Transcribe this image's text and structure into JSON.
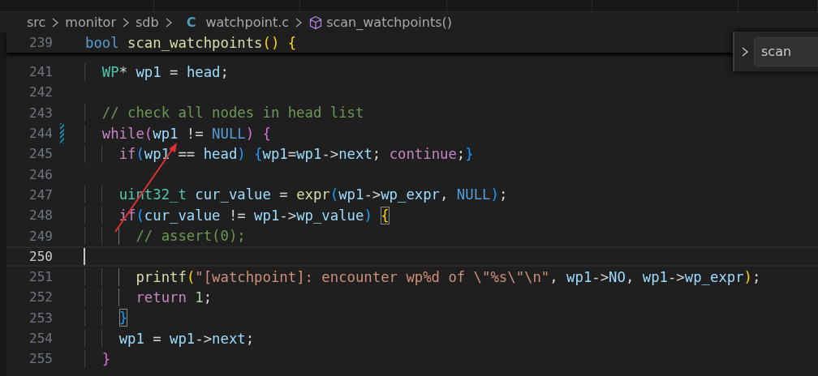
{
  "breadcrumb": {
    "segments": [
      {
        "label": "src",
        "kind": "folder"
      },
      {
        "label": "monitor",
        "kind": "folder"
      },
      {
        "label": "sdb",
        "kind": "folder"
      },
      {
        "label": "watchpoint.c",
        "kind": "file",
        "badge": "C"
      },
      {
        "label": "scan_watchpoints()",
        "kind": "symbol"
      }
    ]
  },
  "sticky_line": {
    "number": "239",
    "tokens": [
      {
        "t": "bool ",
        "color": "#569cd6"
      },
      {
        "t": "scan_watchpoints",
        "color": "#dcdcaa"
      },
      {
        "t": "() {",
        "color": "#ffd700"
      }
    ]
  },
  "lines": [
    {
      "number": "241",
      "current": false,
      "modified": false,
      "tokens": [
        {
          "t": "  WP",
          "color": "#4ec9b0"
        },
        {
          "t": "* ",
          "color": "#d4d4d4"
        },
        {
          "t": "wp1",
          "color": "#9cdcfe"
        },
        {
          "t": " = ",
          "color": "#d4d4d4"
        },
        {
          "t": "head",
          "color": "#9cdcfe"
        },
        {
          "t": ";",
          "color": "#d4d4d4"
        }
      ]
    },
    {
      "number": "242",
      "current": false,
      "modified": false
    },
    {
      "number": "243",
      "current": false,
      "modified": false,
      "tokens": [
        {
          "t": "  // check all nodes in head list",
          "color": "#6a9955"
        }
      ]
    },
    {
      "number": "244",
      "current": false,
      "modified": true,
      "tokens": [
        {
          "t": "  while",
          "color": "#c586c0"
        },
        {
          "t": "(",
          "color": "#da70d6"
        },
        {
          "t": "wp1",
          "color": "#9cdcfe"
        },
        {
          "t": " != ",
          "color": "#d4d4d4"
        },
        {
          "t": "NULL",
          "color": "#569cd6"
        },
        {
          "t": ") {",
          "color": "#da70d6"
        }
      ]
    },
    {
      "number": "245",
      "current": false,
      "modified": false,
      "tokens": [
        {
          "t": "    if",
          "color": "#c586c0"
        },
        {
          "t": "(",
          "color": "#179fff"
        },
        {
          "t": "wp1",
          "color": "#9cdcfe"
        },
        {
          "t": " == ",
          "color": "#d4d4d4"
        },
        {
          "t": "head",
          "color": "#9cdcfe"
        },
        {
          "t": ") {",
          "color": "#179fff"
        },
        {
          "t": "wp1",
          "color": "#9cdcfe"
        },
        {
          "t": "=",
          "color": "#d4d4d4"
        },
        {
          "t": "wp1",
          "color": "#9cdcfe"
        },
        {
          "t": "->",
          "color": "#d4d4d4"
        },
        {
          "t": "next",
          "color": "#9cdcfe"
        },
        {
          "t": "; ",
          "color": "#d4d4d4"
        },
        {
          "t": "continue",
          "color": "#c586c0"
        },
        {
          "t": ";",
          "color": "#d4d4d4"
        },
        {
          "t": "}",
          "color": "#179fff"
        }
      ]
    },
    {
      "number": "246",
      "current": false,
      "modified": false
    },
    {
      "number": "247",
      "current": false,
      "modified": false,
      "tokens": [
        {
          "t": "    uint32_t",
          "color": "#4ec9b0"
        },
        {
          "t": " cur_value",
          "color": "#9cdcfe"
        },
        {
          "t": " = ",
          "color": "#d4d4d4"
        },
        {
          "t": "expr",
          "color": "#dcdcaa"
        },
        {
          "t": "(",
          "color": "#179fff"
        },
        {
          "t": "wp1",
          "color": "#9cdcfe"
        },
        {
          "t": "->",
          "color": "#d4d4d4"
        },
        {
          "t": "wp_expr",
          "color": "#9cdcfe"
        },
        {
          "t": ", ",
          "color": "#d4d4d4"
        },
        {
          "t": "NULL",
          "color": "#569cd6"
        },
        {
          "t": ")",
          "color": "#179fff"
        },
        {
          "t": ";",
          "color": "#d4d4d4"
        }
      ]
    },
    {
      "number": "248",
      "current": false,
      "modified": false,
      "tokens": [
        {
          "t": "    if",
          "color": "#c586c0"
        },
        {
          "t": "(",
          "color": "#179fff"
        },
        {
          "t": "cur_value",
          "color": "#9cdcfe"
        },
        {
          "t": " != ",
          "color": "#d4d4d4"
        },
        {
          "t": "wp1",
          "color": "#9cdcfe"
        },
        {
          "t": "->",
          "color": "#d4d4d4"
        },
        {
          "t": "wp_value",
          "color": "#9cdcfe"
        },
        {
          "t": ") ",
          "color": "#179fff"
        },
        {
          "t": "{",
          "color": "#ffd700",
          "boxed": true
        }
      ]
    },
    {
      "number": "249",
      "current": false,
      "modified": false,
      "tokens": [
        {
          "t": "      // assert(0);",
          "color": "#6a9955"
        }
      ]
    },
    {
      "number": "250",
      "current": true,
      "modified": false
    },
    {
      "number": "251",
      "current": false,
      "modified": false,
      "tokens": [
        {
          "t": "      printf",
          "color": "#dcdcaa"
        },
        {
          "t": "(",
          "color": "#ffd700"
        },
        {
          "t": "\"[watchpoint]: encounter wp%d of \\\"%s\\\"\\n\"",
          "color": "#ce9178"
        },
        {
          "t": ", ",
          "color": "#d4d4d4"
        },
        {
          "t": "wp1",
          "color": "#9cdcfe"
        },
        {
          "t": "->",
          "color": "#d4d4d4"
        },
        {
          "t": "NO",
          "color": "#9cdcfe"
        },
        {
          "t": ", ",
          "color": "#d4d4d4"
        },
        {
          "t": "wp1",
          "color": "#9cdcfe"
        },
        {
          "t": "->",
          "color": "#d4d4d4"
        },
        {
          "t": "wp_expr",
          "color": "#9cdcfe"
        },
        {
          "t": ")",
          "color": "#ffd700"
        },
        {
          "t": ";",
          "color": "#d4d4d4"
        }
      ]
    },
    {
      "number": "252",
      "current": false,
      "modified": false,
      "tokens": [
        {
          "t": "      return",
          "color": "#c586c0"
        },
        {
          "t": " 1",
          "color": "#b5cea8"
        },
        {
          "t": ";",
          "color": "#d4d4d4"
        }
      ]
    },
    {
      "number": "253",
      "current": false,
      "modified": false,
      "tokens": [
        {
          "t": "    }",
          "color": "#179fff",
          "boxed": true
        }
      ]
    },
    {
      "number": "254",
      "current": false,
      "modified": false,
      "tokens": [
        {
          "t": "    wp1",
          "color": "#9cdcfe"
        },
        {
          "t": " = ",
          "color": "#d4d4d4"
        },
        {
          "t": "wp1",
          "color": "#9cdcfe"
        },
        {
          "t": "->",
          "color": "#d4d4d4"
        },
        {
          "t": "next",
          "color": "#9cdcfe"
        },
        {
          "t": ";",
          "color": "#d4d4d4"
        }
      ]
    },
    {
      "number": "255",
      "current": false,
      "modified": false,
      "tokens": [
        {
          "t": "  }",
          "color": "#da70d6"
        }
      ]
    }
  ],
  "find_widget": {
    "value": "scan"
  }
}
